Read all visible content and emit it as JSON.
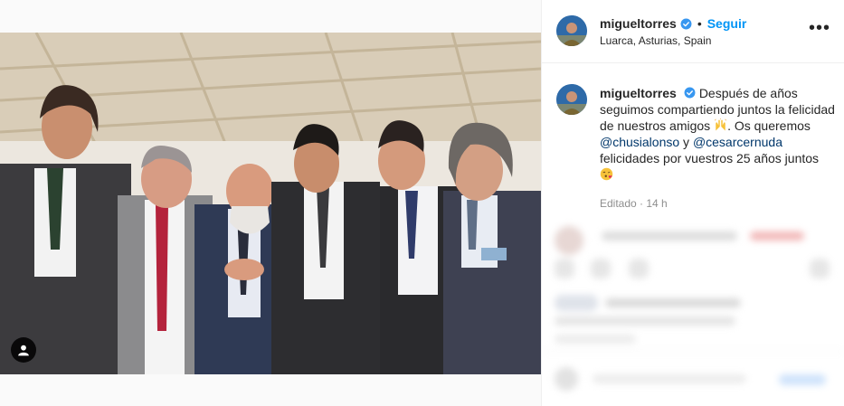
{
  "post": {
    "username": "migueltorres",
    "follow_label": "Seguir",
    "separator": "•",
    "location": "Luarca, Asturias, Spain",
    "more_label": "•••",
    "caption": {
      "part1": "Después de años seguimos compartiendo juntos la felicidad de nuestros amigos",
      "part2": ". Os queremos",
      "mention1": "@chusialonso",
      "part3": "y",
      "mention2": "@cesarcernuda",
      "part4": "felicidades por vuestros 25 años juntos"
    },
    "meta": "Editado · 14 h"
  },
  "icons": {
    "verified": "verified-badge-icon",
    "tag": "user-tag-icon",
    "more": "more-options-icon",
    "emoji_hands": "raising-hands-emoji",
    "emoji_kiss": "face-blowing-kiss-emoji"
  },
  "colors": {
    "link_blue": "#0095f6",
    "mention": "#00376b",
    "verified": "#3897f0",
    "muted": "#8e8e8e"
  }
}
